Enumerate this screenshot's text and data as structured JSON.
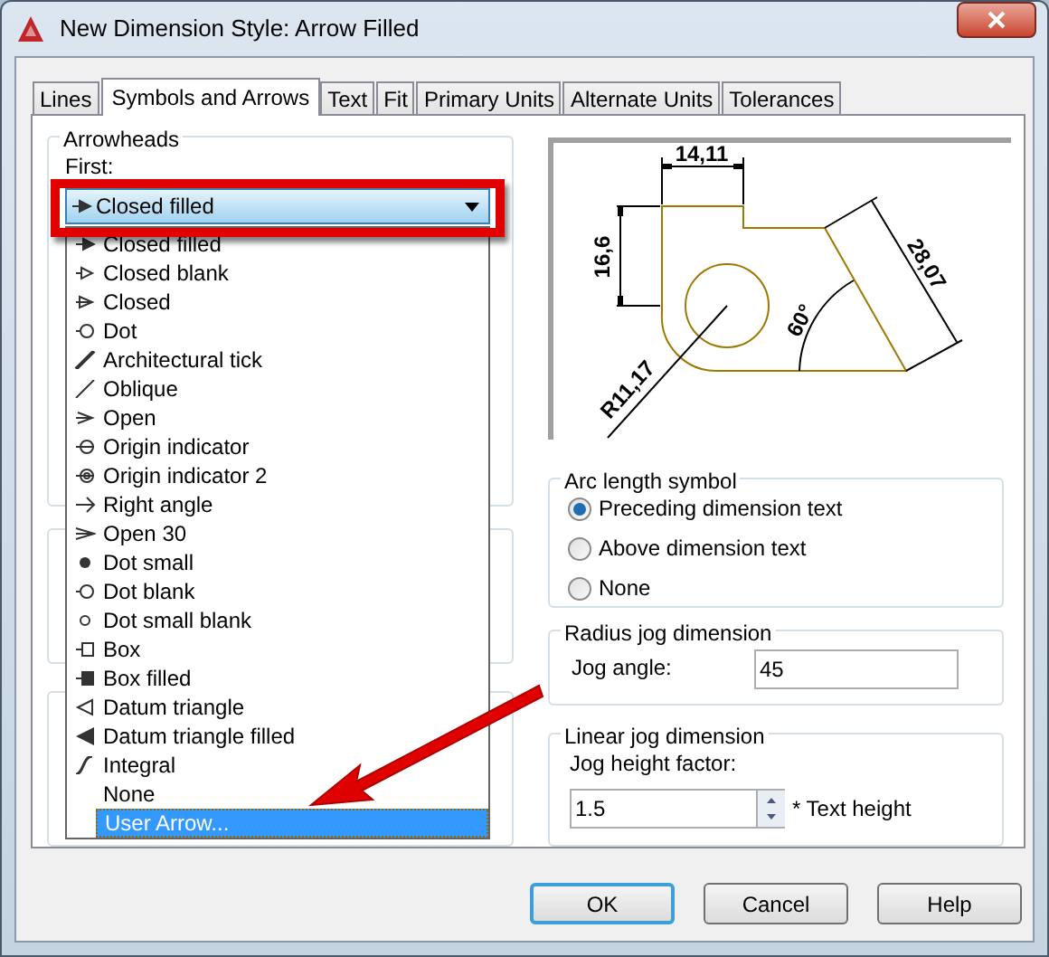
{
  "window": {
    "title": "New Dimension Style: Arrow Filled"
  },
  "tabs": [
    {
      "label": "Lines",
      "selected": false
    },
    {
      "label": "Symbols and Arrows",
      "selected": true
    },
    {
      "label": "Text",
      "selected": false
    },
    {
      "label": "Fit",
      "selected": false
    },
    {
      "label": "Primary Units",
      "selected": false
    },
    {
      "label": "Alternate Units",
      "selected": false
    },
    {
      "label": "Tolerances",
      "selected": false
    }
  ],
  "arrowheads": {
    "title": "Arrowheads",
    "first_label": "First:",
    "first_value": "Closed filled",
    "dropdown_items": [
      {
        "label": "Closed filled",
        "kind": "filled",
        "selected": false
      },
      {
        "label": "Closed blank",
        "kind": "blank",
        "selected": false
      },
      {
        "label": "Closed",
        "kind": "closed",
        "selected": false
      },
      {
        "label": "Dot",
        "kind": "dot",
        "selected": false
      },
      {
        "label": "Architectural tick",
        "kind": "tick",
        "selected": false
      },
      {
        "label": "Oblique",
        "kind": "oblique",
        "selected": false
      },
      {
        "label": "Open",
        "kind": "open",
        "selected": false
      },
      {
        "label": "Origin indicator",
        "kind": "origin",
        "selected": false
      },
      {
        "label": "Origin indicator 2",
        "kind": "origin2",
        "selected": false
      },
      {
        "label": "Right angle",
        "kind": "right",
        "selected": false
      },
      {
        "label": "Open 30",
        "kind": "open30",
        "selected": false
      },
      {
        "label": "Dot small",
        "kind": "dotsmall",
        "selected": false
      },
      {
        "label": "Dot blank",
        "kind": "dotblank",
        "selected": false
      },
      {
        "label": "Dot small blank",
        "kind": "dotsmallblank",
        "selected": false
      },
      {
        "label": "Box",
        "kind": "box",
        "selected": false
      },
      {
        "label": "Box filled",
        "kind": "boxfilled",
        "selected": false
      },
      {
        "label": "Datum triangle",
        "kind": "datum",
        "selected": false
      },
      {
        "label": "Datum triangle filled",
        "kind": "datumfilled",
        "selected": false
      },
      {
        "label": "Integral",
        "kind": "integral",
        "selected": false
      },
      {
        "label": "None",
        "kind": "none",
        "selected": false
      },
      {
        "label": "User Arrow...",
        "kind": "none",
        "selected": true
      }
    ]
  },
  "preview": {
    "labels": [
      "14,11",
      "16,6",
      "28,07",
      "60°",
      "R11,17"
    ]
  },
  "arc_length_symbol": {
    "title": "Arc length symbol",
    "options": [
      {
        "label": "Preceding dimension text",
        "selected": true
      },
      {
        "label": "Above dimension text",
        "selected": false
      },
      {
        "label": "None",
        "selected": false
      }
    ]
  },
  "radius_jog": {
    "title": "Radius jog dimension",
    "label": "Jog angle:",
    "value": "45"
  },
  "linear_jog": {
    "title": "Linear jog dimension",
    "label": "Jog height factor:",
    "value": "1.5",
    "suffix": "* Text height"
  },
  "buttons": [
    {
      "label": "OK",
      "default": true
    },
    {
      "label": "Cancel",
      "default": false
    },
    {
      "label": "Help",
      "default": false
    }
  ]
}
